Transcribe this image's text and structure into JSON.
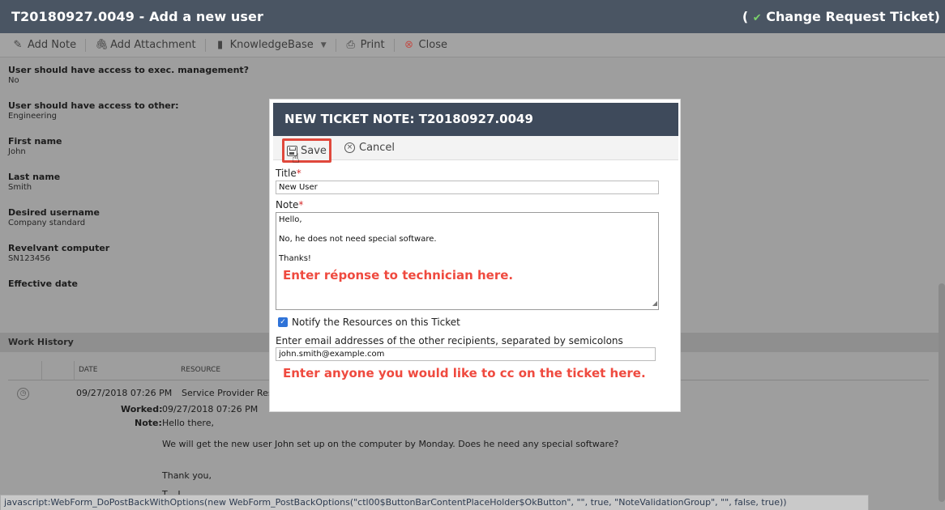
{
  "header": {
    "title": "T20180927.0049 - Add a new user",
    "ticket_type_open": "(",
    "ticket_type_icon": "✔",
    "ticket_type": "Change Request Ticket)"
  },
  "toolbar": {
    "add_note": "Add Note",
    "add_attachment": "Add Attachment",
    "knowledgebase": "KnowledgeBase",
    "print": "Print",
    "close": "Close"
  },
  "fields": [
    {
      "label": "User should have access to exec. management?",
      "value": "No"
    },
    {
      "label": "User should have access to other:",
      "value": "Engineering"
    },
    {
      "label": "First name",
      "value": "John"
    },
    {
      "label": "Last name",
      "value": "Smith"
    },
    {
      "label": "Desired username",
      "value": "Company standard"
    },
    {
      "label": "Revelvant computer",
      "value": "SN123456"
    },
    {
      "label": "Effective date",
      "value": ""
    }
  ],
  "work_history": {
    "title": "Work History",
    "col_date": "DATE",
    "col_resource": "RESOURCE",
    "entry": {
      "date": "09/27/2018 07:26 PM",
      "resource": "Service Provider Resou",
      "worked_label": "Worked:",
      "worked_value": "09/27/2018 07:26 PM",
      "note_label": "Note:",
      "note_line1": "Hello there,",
      "note_line2": "We will get the new user John set up on the computer by Monday. Does he need any special software?",
      "note_line3": "Thank you,",
      "note_line4": "T... L..."
    }
  },
  "modal": {
    "title": "NEW TICKET NOTE: T20180927.0049",
    "save": "Save",
    "cancel": "Cancel",
    "title_label": "Title",
    "title_value": "New User",
    "note_label": "Note",
    "note_lines": [
      "Hello,",
      "No, he does not need special software.",
      "Thanks!"
    ],
    "annotation_note": "Enter réponse to technician here.",
    "notify_label": "Notify the Resources on this Ticket",
    "notify_checked": true,
    "email_label": "Enter email addresses of the other recipients, separated by semicolons",
    "email_value": "john.smith@example.com",
    "annotation_email": "Enter anyone you would like to cc on the ticket here."
  },
  "statusbar": {
    "text": "javascript:WebForm_DoPostBackWithOptions(new WebForm_PostBackOptions(\"ctl00$ButtonBarContentPlaceHolder$OkButton\", \"\", true, \"NoteValidationGroup\", \"\", false, true))"
  },
  "colors": {
    "header_bg": "#4a5563",
    "modal_header_bg": "#3e4a5b",
    "annotation_red": "#ef4a3f",
    "highlight_border": "#e0483c",
    "checkbox_blue": "#2f73d8"
  }
}
